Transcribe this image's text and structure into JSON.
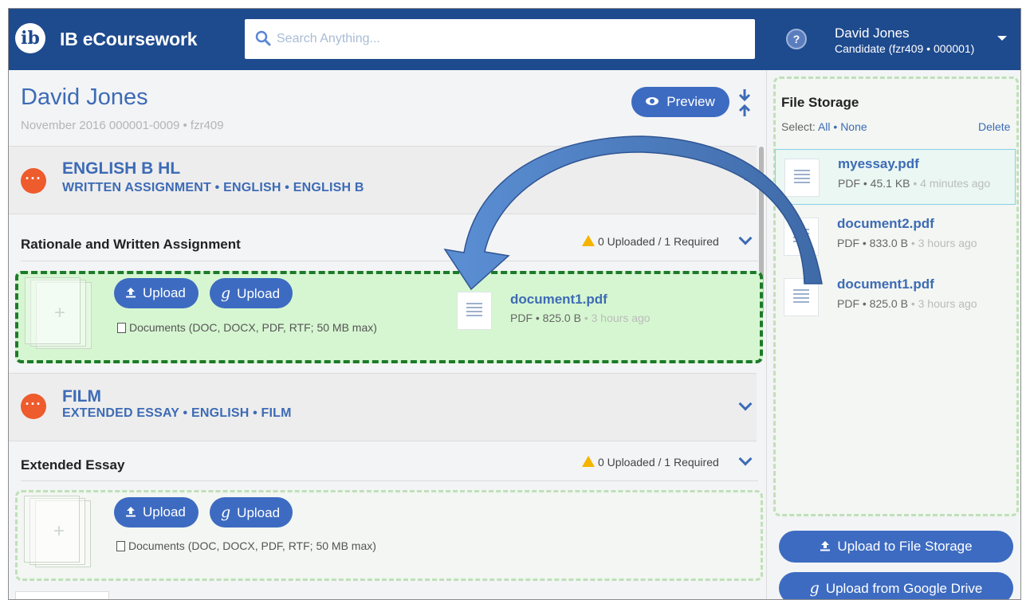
{
  "header": {
    "app_title": "IB eCoursework",
    "logo_text": "ib",
    "search_placeholder": "Search Anything...",
    "user_name": "David Jones",
    "user_role": "Candidate (fzr409 • 000001)"
  },
  "candidate": {
    "name": "David Jones",
    "details": "November 2016 000001-0009 • fzr409",
    "preview_label": "Preview"
  },
  "subjects": [
    {
      "title": "ENGLISH B HL",
      "subtitle": "WRITTEN ASSIGNMENT • ENGLISH • ENGLISH B",
      "component": "Rationale and Written Assignment",
      "status": "0 Uploaded / 1 Required",
      "upload_label": "Upload",
      "gdrive_label": "Upload",
      "doc_types": "Documents (DOC, DOCX, PDF, RTF; 50 MB max)",
      "dragged_file": {
        "name": "document1.pdf",
        "meta": "PDF • 825.0 B",
        "ago": "• 3 hours ago"
      }
    },
    {
      "title": "FILM",
      "subtitle": "EXTENDED ESSAY • ENGLISH • FILM",
      "component": "Extended Essay",
      "status": "0 Uploaded / 1 Required",
      "upload_label": "Upload",
      "gdrive_label": "Upload",
      "doc_types": "Documents (DOC, DOCX, PDF, RTF; 50 MB max)"
    }
  ],
  "storage": {
    "title": "File Storage",
    "select_label": "Select:",
    "select_all": "All",
    "select_sep": "•",
    "select_none": "None",
    "delete_label": "Delete",
    "files": [
      {
        "name": "myessay.pdf",
        "meta": "PDF • 45.1 KB",
        "ago": "• 4 minutes ago",
        "selected": true
      },
      {
        "name": "document2.pdf",
        "meta": "PDF • 833.0 B",
        "ago": "• 3 hours ago",
        "selected": false
      },
      {
        "name": "document1.pdf",
        "meta": "PDF • 825.0 B",
        "ago": "• 3 hours ago",
        "selected": false
      }
    ],
    "upload_storage_label": "Upload to File Storage",
    "upload_gdrive_label": "Upload from Google Drive"
  },
  "colors": {
    "brand": "#1e4a8e",
    "accent": "#3d6bc1",
    "subject_icon": "#ee5b2c",
    "drop_active_bg": "#d6f6d1",
    "drop_active_border": "#1d7a2a",
    "warning": "#f5b400"
  },
  "icons": [
    "ib-logo",
    "search-icon",
    "help-icon",
    "chevron-down-icon",
    "eye-icon",
    "collapse-arrows-icon",
    "more-dots-icon",
    "warning-icon",
    "upload-icon",
    "google-drive-icon",
    "document-icon",
    "drag-arrow"
  ]
}
